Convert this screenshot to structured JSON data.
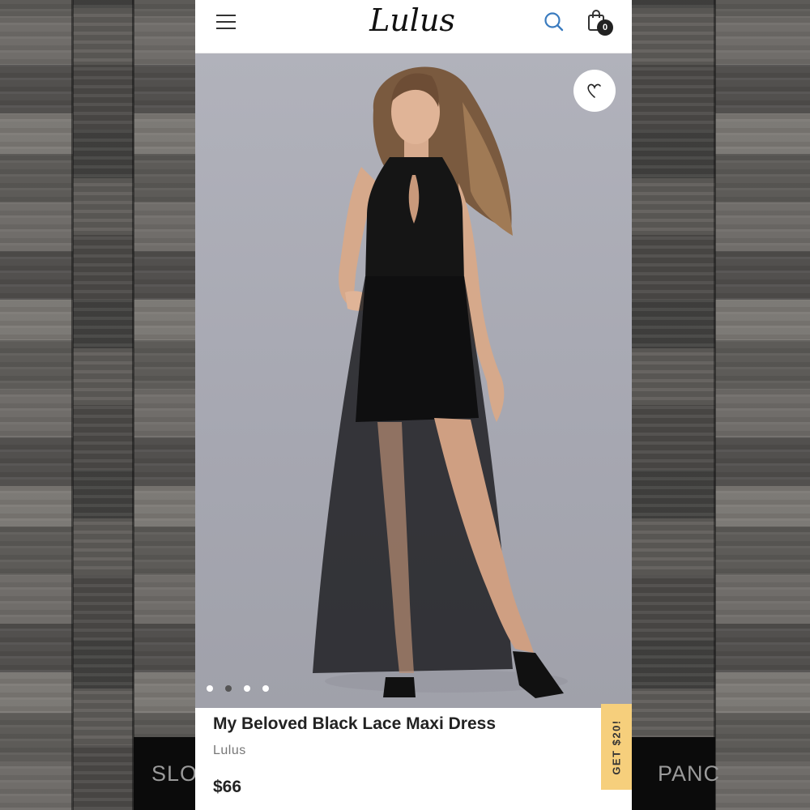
{
  "header": {
    "menu_icon": "hamburger-menu-icon",
    "logo": "Lulus",
    "search_icon": "search-icon",
    "cart_icon": "shopping-bag-icon",
    "cart_count": "0"
  },
  "product": {
    "title": "My Beloved Black Lace Maxi Dress",
    "brand": "Lulus",
    "price": "$66",
    "wishlist_icon": "heart-icon",
    "carousel": {
      "total": 4,
      "active_index": 1
    }
  },
  "promo": {
    "label": "GET $20!"
  },
  "background_tiles": {
    "left_label": "SLO-",
    "right_label": "PANC"
  },
  "colors": {
    "accent_search": "#3a7bbf",
    "promo_bg": "#f6cf7c",
    "hero_bg": "#a9aab3"
  }
}
